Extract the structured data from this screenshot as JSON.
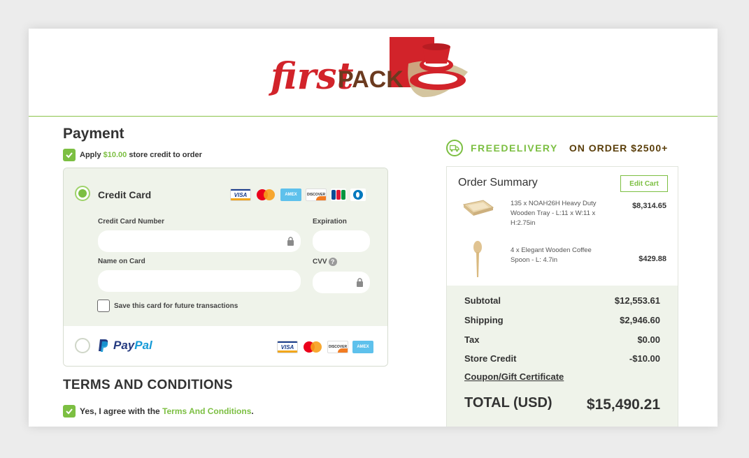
{
  "brand": {
    "logo_script": "first",
    "logo_block": "PACK"
  },
  "payment": {
    "title": "Payment",
    "store_credit": {
      "prefix": "Apply ",
      "amount": "$10.00",
      "suffix": " store credit to order",
      "checked": true
    },
    "methods": {
      "credit_card": {
        "label": "Credit Card",
        "selected": true,
        "card_icons": [
          "visa-icon",
          "mastercard-icon",
          "amex-icon",
          "discover-icon",
          "jcb-icon",
          "diners-club-icon"
        ],
        "number_label": "Credit Card Number",
        "number_value": "",
        "expiration_label": "Expiration",
        "expiration_value": "",
        "name_label": "Name on Card",
        "name_value": "",
        "cvv_label": "CVV",
        "cvv_help": "?",
        "cvv_value": "",
        "save_label": "Save this card for future transactions",
        "save_checked": false
      },
      "paypal": {
        "label_a": "Pay",
        "label_b": "Pal",
        "selected": false,
        "card_icons": [
          "visa-icon",
          "mastercard-icon",
          "discover-icon",
          "amex-icon"
        ]
      }
    },
    "card_labels": {
      "visa": "VISA",
      "amex": "AMEX",
      "discover": "DISCOVER"
    }
  },
  "terms": {
    "title": "TERMS AND CONDITIONS",
    "agree_prefix": "Yes, I agree with the ",
    "agree_link": "Terms And Conditions",
    "agree_suffix": ".",
    "checked": true
  },
  "promo": {
    "free_delivery": "FREEDELIVERY",
    "on_order": "ON ORDER $2500+"
  },
  "order_summary": {
    "title": "Order Summary",
    "edit_cart": "Edit Cart",
    "items": [
      {
        "desc": "135 x NOAH26H Heavy Duty Wooden Tray - L:11 x W:11 x H:2.75in",
        "price": "$8,314.65"
      },
      {
        "desc": "4 x Elegant Wooden Coffee Spoon - L: 4.7in",
        "price": "$429.88"
      }
    ],
    "subtotal_label": "Subtotal",
    "subtotal": "$12,553.61",
    "shipping_label": "Shipping",
    "shipping": "$2,946.60",
    "tax_label": "Tax",
    "tax": "$0.00",
    "store_credit_label": "Store Credit",
    "store_credit": "-$10.00",
    "coupon_label": "Coupon/Gift Certificate",
    "total_label": "TOTAL (USD)",
    "total": "$15,490.21"
  },
  "colors": {
    "accent": "#7cbf42",
    "brand_red": "#d2232a",
    "brand_brown": "#5a3e0a",
    "panel": "#eff3ea"
  }
}
